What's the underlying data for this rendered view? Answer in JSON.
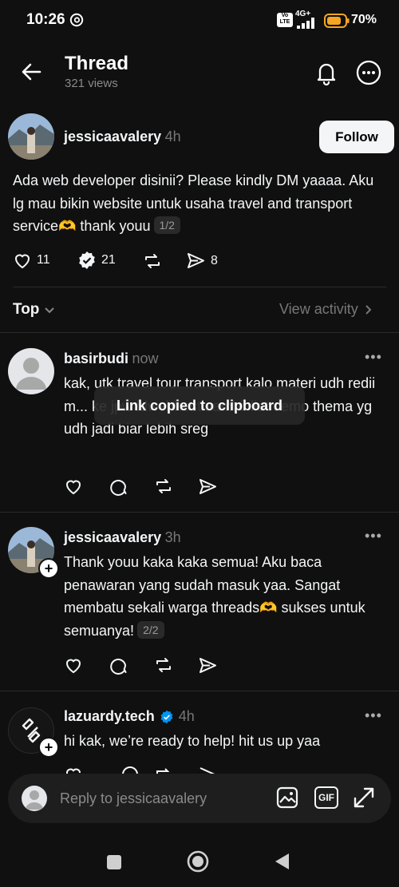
{
  "status_bar": {
    "time": "10:26",
    "battery": "70%",
    "network": "4G+",
    "volte": "Vo LTE"
  },
  "header": {
    "title": "Thread",
    "views": "321 views"
  },
  "main_post": {
    "username": "jessicaavalery",
    "time": "4h",
    "follow_label": "Follow",
    "text": "Ada web developer disinii? Please kindly DM yaaaa. Aku lg mau bikin website untuk usaha travel and transport service🫶 thank youu",
    "pager": "1/2",
    "likes": "11",
    "replies": "21",
    "shares": "8"
  },
  "sort": {
    "label": "Top",
    "view_activity": "View activity"
  },
  "replies": [
    {
      "username": "basirbudi",
      "time": "now",
      "text": "kak, utk travel tour transport kalo materi udh redii m... ke jpw ldwebhost sambil liat demo thema yg udh jadi biar lebih sreg"
    },
    {
      "username": "jessicaavalery",
      "time": "3h",
      "text": "Thank youu kaka kaka semua! Aku baca penawaran yang sudah masuk yaa. Sangat membatu sekali warga threads🫶 sukses untuk semuanya!",
      "pager": "2/2"
    },
    {
      "username": "lazuardy.tech",
      "time": "4h",
      "text": "hi kak, we’re ready to help! hit us up yaa"
    }
  ],
  "toast": "Link copied to clipboard",
  "composer": {
    "placeholder": "Reply to jessicaavalery",
    "gif_label": "GIF"
  },
  "colors": {
    "background": "#101010",
    "text": "#f3f5f7",
    "muted": "#777777",
    "verified": "#0095f6",
    "battery": "#f5a623"
  }
}
